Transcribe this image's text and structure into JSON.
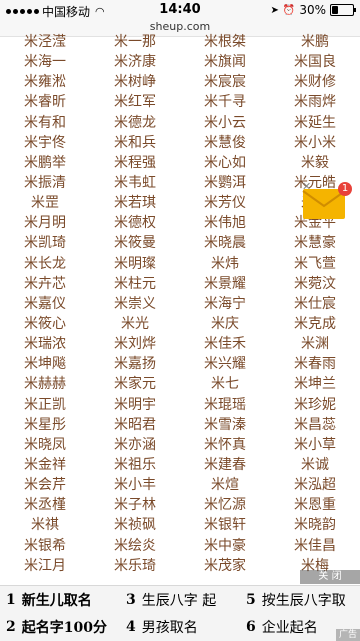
{
  "status_bar": {
    "carrier": "中国移动",
    "time": "14:40",
    "battery": "30%",
    "battery_fraction": 0.3
  },
  "url_bar": {
    "url": "sheup.com"
  },
  "names": [
    "米泾滢",
    "米一那",
    "米根桀",
    "米鹏",
    "米海一",
    "米济康",
    "米旗闻",
    "米国良",
    "米雍淞",
    "米树峥",
    "米宸宸",
    "米财修",
    "米睿昕",
    "米红军",
    "米千寻",
    "米雨烨",
    "米有和",
    "米德龙",
    "米小云",
    "米延生",
    "米宇佟",
    "米和兵",
    "米慧俊",
    "米小米",
    "米鹏举",
    "米程强",
    "米心如",
    "米毅",
    "米振清",
    "米韦虹",
    "米鹦洱",
    "米元皓",
    "米罡",
    "米若琪",
    "米芳仪",
    "米东",
    "米月明",
    "米德权",
    "米伟旭",
    "米金平",
    "米凯琦",
    "米筱曼",
    "米晓晨",
    "米慧豪",
    "米长龙",
    "米明璨",
    "米炜",
    "米飞萱",
    "米卉芯",
    "米柱元",
    "米景耀",
    "米菀汶",
    "米嘉仪",
    "米崇义",
    "米海宁",
    "米仕宸",
    "米筱心",
    "米光",
    "米庆",
    "米克成",
    "米瑞浓",
    "米刘烨",
    "米佳禾",
    "米渊",
    "米坤飚",
    "米嘉扬",
    "米兴耀",
    "米春雨",
    "米赫赫",
    "米家元",
    "米七",
    "米坤兰",
    "米正凯",
    "米明宇",
    "米琨瑶",
    "米珍妮",
    "米星彤",
    "米昭君",
    "米雪溱",
    "米昌蕊",
    "米晓凤",
    "米亦涵",
    "米怀真",
    "米小草",
    "米金祥",
    "米祖乐",
    "米建春",
    "米诚",
    "米会芹",
    "米小丰",
    "米煊",
    "米泓超",
    "米丞槿",
    "米子林",
    "米忆源",
    "米恩重",
    "米祺",
    "米祯砜",
    "米银轩",
    "米晓韵",
    "米银希",
    "米绘炎",
    "米中豪",
    "米佳昌",
    "米江月",
    "米乐琦",
    "米茂家",
    "米梅"
  ],
  "float_widget": {
    "close_symbol": "✕",
    "badge_count": "1",
    "icon": "mail-icon"
  },
  "ad": {
    "close_label": "关 闭",
    "tag": "广告",
    "items": [
      {
        "num": "1",
        "label": "新生儿取名"
      },
      {
        "num": "3",
        "label": "生辰八字 起"
      },
      {
        "num": "5",
        "label": "按生辰八字取"
      },
      {
        "num": "2",
        "label": "起名字100分"
      },
      {
        "num": "4",
        "label": "男孩取名"
      },
      {
        "num": "6",
        "label": "企业起名"
      }
    ]
  },
  "colors": {
    "name_text": "#7a4a2a",
    "badge": "#e8423a",
    "mail": "#f5b400"
  }
}
